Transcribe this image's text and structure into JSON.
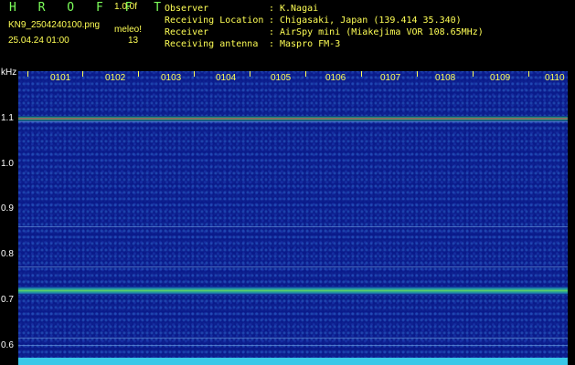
{
  "header": {
    "brand": "H R O F F T",
    "version": "1.0.0f",
    "filename": "KN9_2504240100.png",
    "camera": "meleo!",
    "datetime": "25.04.24 01:00",
    "count": "13"
  },
  "info": [
    {
      "label": "Observer",
      "value": "K.Nagai"
    },
    {
      "label": "Receiving Location",
      "value": "Chigasaki, Japan (139.414 35.340)"
    },
    {
      "label": "Receiver",
      "value": "AirSpy mini (Miakejima VOR 108.65MHz)"
    },
    {
      "label": "Receiving antenna",
      "value": "Maspro FM-3"
    }
  ],
  "separator": ":",
  "axis": {
    "unit": "kHz",
    "y_labels": [
      "1.1",
      "1.0",
      "0.9",
      "0.8",
      "0.7",
      "0.6"
    ],
    "x_labels": [
      "0101",
      "0102",
      "0103",
      "0104",
      "0105",
      "0106",
      "0107",
      "0108",
      "0109",
      "0110"
    ]
  }
}
